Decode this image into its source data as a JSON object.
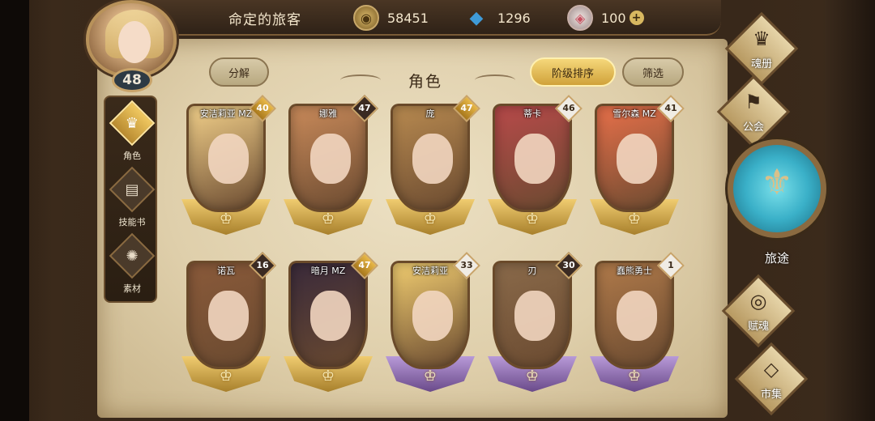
{
  "header": {
    "player_name": "命定的旅客",
    "level": "48",
    "gold": "58451",
    "gems": "1296",
    "crystals": "100",
    "plus": "+"
  },
  "left_tabs": [
    {
      "label": "角色",
      "icon": "helmet-icon",
      "glyph": "♛",
      "active": true
    },
    {
      "label": "技能书",
      "icon": "skill-book-icon",
      "glyph": "▤",
      "active": false
    },
    {
      "label": "素材",
      "icon": "material-icon",
      "glyph": "✺",
      "active": false
    }
  ],
  "toolbar": {
    "decompose": "分解",
    "title": "角色",
    "sort": "阶级排序",
    "filter": "筛选"
  },
  "heroes": [
    {
      "name": "安洁莉亚 MZ",
      "level": "40",
      "badge": "gold",
      "base": "gold",
      "portrait": "#f2d08a"
    },
    {
      "name": "娜雅",
      "level": "47",
      "badge": "dark",
      "base": "gold",
      "portrait": "#c98a5a"
    },
    {
      "name": "庞",
      "level": "47",
      "badge": "gold",
      "base": "gold",
      "portrait": "#b88a50"
    },
    {
      "name": "蒂卡",
      "level": "46",
      "badge": "light",
      "base": "gold",
      "portrait": "#b84a4a"
    },
    {
      "name": "雪尔森 MZ",
      "level": "41",
      "badge": "light",
      "base": "gold",
      "portrait": "#e8704a"
    },
    {
      "name": "诺瓦",
      "level": "16",
      "badge": "dark",
      "base": "gold",
      "portrait": "#8a5a3a"
    },
    {
      "name": "暗月 MZ",
      "level": "47",
      "badge": "gold",
      "base": "gold",
      "portrait": "#3a2a3a"
    },
    {
      "name": "安洁莉亚",
      "level": "33",
      "badge": "light",
      "base": "purple",
      "portrait": "#f0cc70"
    },
    {
      "name": "刃",
      "level": "30",
      "badge": "dark",
      "base": "purple",
      "portrait": "#8a6a4a"
    },
    {
      "name": "蠢熊勇士",
      "level": "1",
      "badge": "light",
      "base": "purple",
      "portrait": "#b07a4a"
    }
  ],
  "right_nav": {
    "soul_book": "魂册",
    "guild": "公会",
    "journey": "旅途",
    "endow": "赋魂",
    "market": "市集"
  }
}
